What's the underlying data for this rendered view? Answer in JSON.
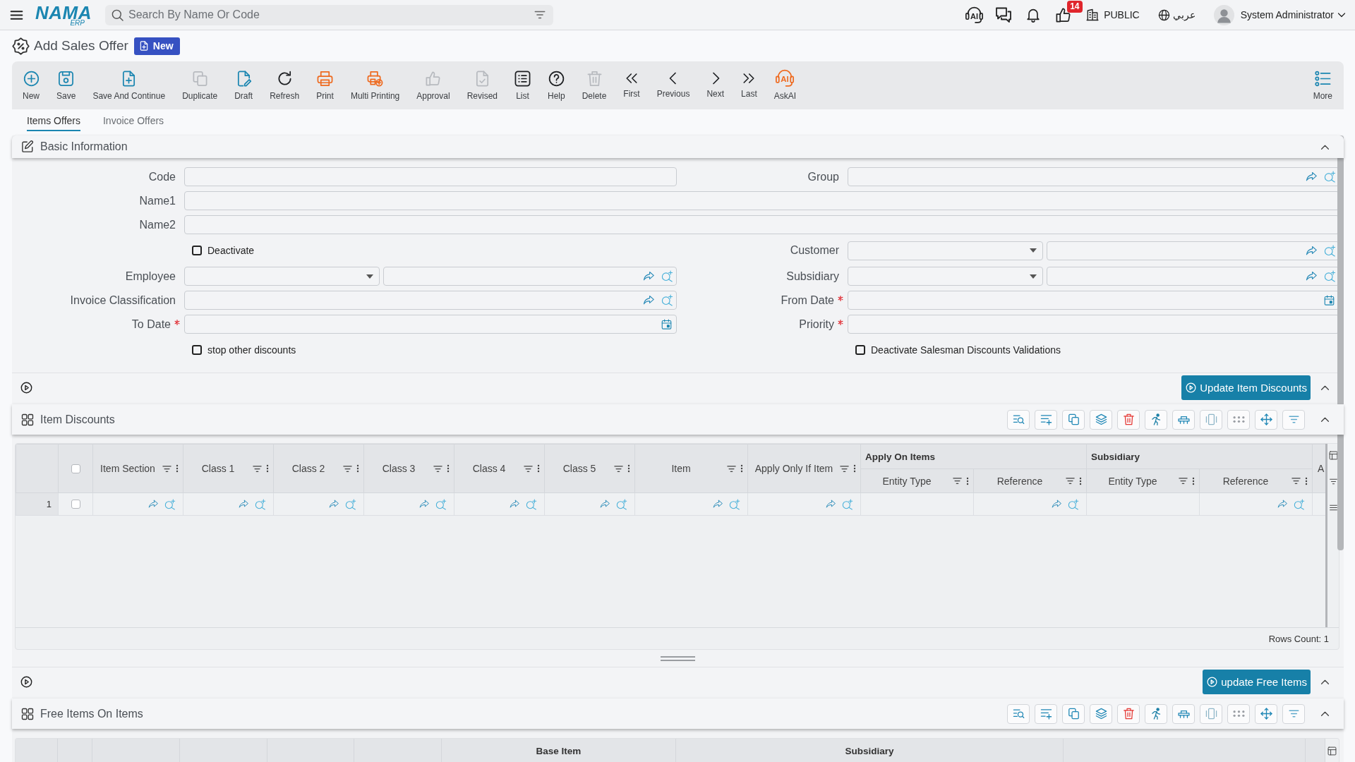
{
  "top_bar": {
    "logo": {
      "name": "NAMA",
      "sub": "ERP"
    },
    "search": {
      "placeholder": "Search By Name Or Code"
    },
    "support_icon_text": "AI",
    "notification_count": "14",
    "branch": "PUBLIC",
    "language": "عربي",
    "user": "System Administrator"
  },
  "header": {
    "title": "Add Sales Offer",
    "status": "New"
  },
  "toolbar": [
    {
      "label": "New",
      "disabled": false
    },
    {
      "label": "Save",
      "disabled": false
    },
    {
      "label": "Save And Continue",
      "disabled": false
    },
    {
      "label": "Duplicate",
      "disabled": true
    },
    {
      "label": "Draft",
      "disabled": false
    },
    {
      "label": "Refresh",
      "disabled": false
    },
    {
      "label": "Print",
      "disabled": false
    },
    {
      "label": "Multi Printing",
      "disabled": false
    },
    {
      "label": "Approval",
      "disabled": true
    },
    {
      "label": "Revised",
      "disabled": true
    },
    {
      "label": "List",
      "disabled": false
    },
    {
      "label": "Help",
      "disabled": false
    },
    {
      "label": "Delete",
      "disabled": true
    },
    {
      "label": "First",
      "disabled": false
    },
    {
      "label": "Previous",
      "disabled": false
    },
    {
      "label": "Next",
      "disabled": false
    },
    {
      "label": "Last",
      "disabled": false
    },
    {
      "label": "AskAI",
      "disabled": false,
      "icon_text": "AI"
    }
  ],
  "toolbar_more": {
    "label": "More"
  },
  "tabs": [
    {
      "label": "Items Offers",
      "selected": true
    },
    {
      "label": "Invoice Offers",
      "selected": false
    }
  ],
  "basic_information": {
    "title": "Basic Information",
    "expanded": true,
    "rows": [
      {
        "left": {
          "label": "Code",
          "kind": "text",
          "required": false
        },
        "right": {
          "label": "Group",
          "kind": "lookup",
          "required": false
        }
      },
      {
        "full": {
          "label": "Name1",
          "kind": "text",
          "required": false
        }
      },
      {
        "full": {
          "label": "Name2",
          "kind": "text",
          "required": false
        }
      },
      {
        "left": {
          "label": "Deactivate",
          "kind": "checkbox",
          "checked": false
        },
        "right": {
          "label": "Customer",
          "kind": "select-lookup",
          "required": false
        }
      },
      {
        "left": {
          "label": "Employee",
          "kind": "select-lookup",
          "required": false
        },
        "right": {
          "label": "Subsidiary",
          "kind": "select-lookup",
          "required": false
        }
      },
      {
        "left": {
          "label": "Invoice Classification",
          "kind": "lookup",
          "required": false
        },
        "right": {
          "label": "From Date",
          "kind": "date",
          "required": true
        }
      },
      {
        "left": {
          "label": "To Date",
          "kind": "date",
          "required": true
        },
        "right": {
          "label": "Priority",
          "kind": "text",
          "required": true
        }
      },
      {
        "left": {
          "label": "stop other discounts",
          "kind": "checkbox",
          "checked": false
        },
        "right": {
          "label": "Deactivate Salesman Discounts Validations",
          "kind": "checkbox",
          "checked": false
        }
      }
    ]
  },
  "item_discounts_action": {
    "button": "Update Item Discounts",
    "expanded": true
  },
  "item_discounts": {
    "title": "Item Discounts",
    "expanded": true,
    "all_checked": false,
    "columns": [
      {
        "label": "Item Section",
        "kind": "lookup"
      },
      {
        "label": "Class 1",
        "kind": "lookup"
      },
      {
        "label": "Class 2",
        "kind": "lookup"
      },
      {
        "label": "Class 3",
        "kind": "lookup"
      },
      {
        "label": "Class 4",
        "kind": "lookup"
      },
      {
        "label": "Class 5",
        "kind": "lookup"
      },
      {
        "label": "Item",
        "kind": "lookup"
      },
      {
        "label": "Apply Only If Item",
        "kind": "lookup"
      },
      {
        "label": "Apply On Items",
        "kind": "group",
        "columns": [
          {
            "label": "Entity Type",
            "kind": "select"
          },
          {
            "label": "Reference",
            "kind": "lookup"
          }
        ]
      },
      {
        "label": "Subsidiary",
        "kind": "group",
        "columns": [
          {
            "label": "Entity Type",
            "kind": "select"
          },
          {
            "label": "Reference",
            "kind": "lookup"
          }
        ]
      },
      {
        "label": "A",
        "kind": "plain"
      }
    ],
    "rows": [
      {
        "number": "1",
        "checked": false
      }
    ],
    "rows_count": "Rows Count: 1"
  },
  "free_items_action": {
    "button": "update Free Items",
    "expanded": true
  },
  "free_items": {
    "title": "Free Items On Items",
    "expanded": true,
    "header_groups": [
      "Base Item",
      "Subsidiary"
    ]
  }
}
